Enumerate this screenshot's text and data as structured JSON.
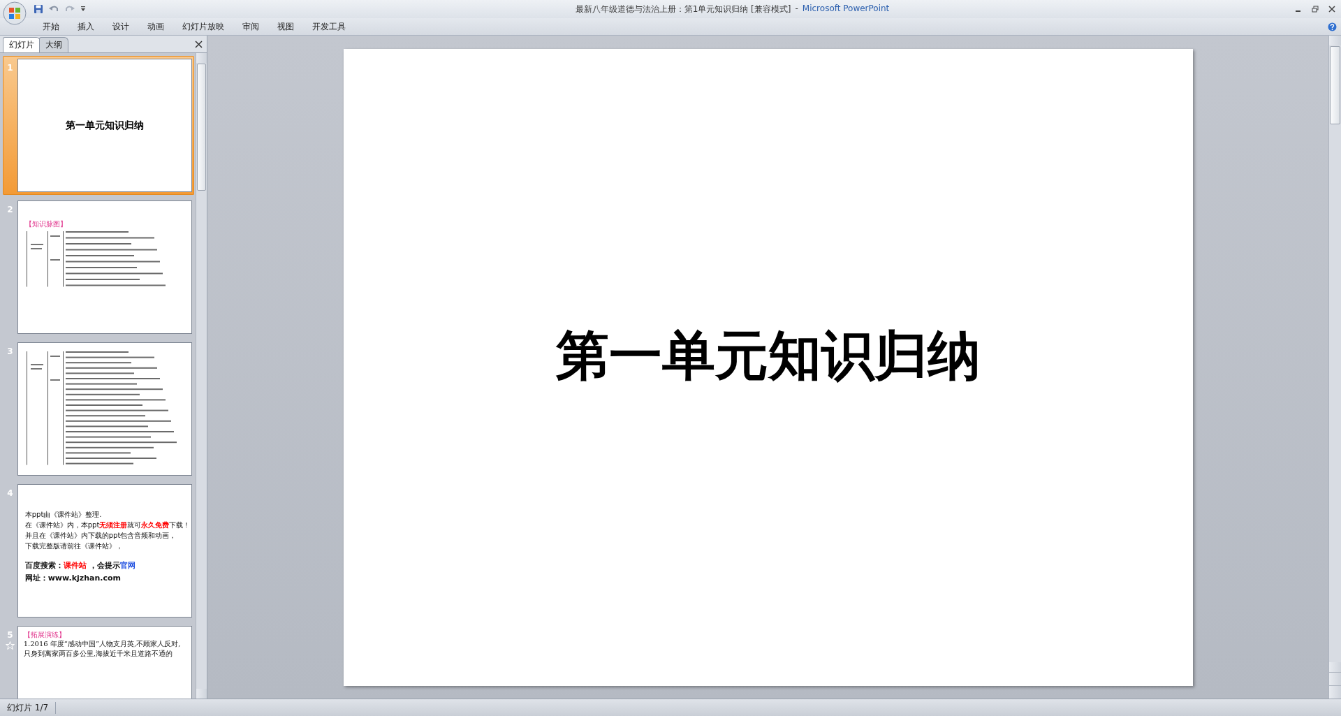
{
  "window": {
    "title": "最新八年级道德与法治上册：第1单元知识归纳 [兼容模式]",
    "separator": "-",
    "app": "Microsoft PowerPoint"
  },
  "menu": [
    "开始",
    "插入",
    "设计",
    "动画",
    "幻灯片放映",
    "审阅",
    "视图",
    "开发工具"
  ],
  "pane_tabs": [
    {
      "label": "幻灯片",
      "selected": true
    },
    {
      "label": "大纲",
      "selected": false
    }
  ],
  "slides": [
    {
      "number": "1",
      "selected": true,
      "kind": "title",
      "animated": false,
      "title": "第一单元知识归纳"
    },
    {
      "number": "2",
      "selected": false,
      "kind": "mindmap",
      "animated": false,
      "heading": "【知识脉图】"
    },
    {
      "number": "3",
      "selected": false,
      "kind": "mindmap",
      "animated": false
    },
    {
      "number": "4",
      "selected": false,
      "kind": "notice",
      "animated": false,
      "lines": [
        {
          "kind": "body",
          "parts": [
            {
              "text": "本ppt由《课件站》整理."
            }
          ]
        },
        {
          "kind": "body",
          "parts": [
            {
              "text": "在《课件站》内，本ppt"
            },
            {
              "text": "无须注册",
              "color": "#ff0000"
            },
            {
              "text": "就可"
            },
            {
              "text": "永久免费",
              "color": "#ff0000"
            },
            {
              "text": "下载！"
            }
          ]
        },
        {
          "kind": "body",
          "parts": [
            {
              "text": "并且在《课件站》内下载的ppt包含音频和动画，"
            }
          ]
        },
        {
          "kind": "body",
          "parts": [
            {
              "text": "下载完整版请前往《课件站》，"
            }
          ]
        },
        {
          "kind": "large",
          "parts": [
            {
              "text": "百度搜索："
            },
            {
              "text": "课件站",
              "color": "#ff0000"
            },
            {
              "text": " ，会提示"
            },
            {
              "text": "官网",
              "color": "#1f4fe0"
            }
          ]
        },
        {
          "kind": "large",
          "parts": [
            {
              "text": "网址：www.kjzhan.com"
            }
          ]
        }
      ]
    },
    {
      "number": "5",
      "selected": false,
      "kind": "exercise",
      "animated": true,
      "heading": "【拓展演练】",
      "lines": [
        "1.2016 年度“感动中国”人物支月英,不顾家人反对,",
        "只身到离家两百多公里,海拔近千米且道路不通的"
      ]
    }
  ],
  "main_slide": {
    "title": "第一单元知识归纳"
  },
  "status_bar": {
    "slide_indicator": "幻灯片 1/7"
  }
}
